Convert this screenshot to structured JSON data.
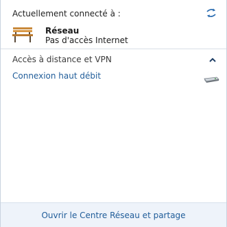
{
  "header": {
    "connected_label": "Actuellement connecté à :",
    "refresh_icon": "refresh-arrows-icon"
  },
  "network": {
    "name": "Réseau",
    "status": "Pas d'accès Internet",
    "icon": "park-bench-icon"
  },
  "group": {
    "title": "Accès à distance et VPN",
    "collapse_icon": "chevron-up-icon",
    "items": [
      {
        "label": "Connexion haut débit",
        "icon": "modem-icon"
      }
    ]
  },
  "footer": {
    "link_label": "Ouvrir le Centre Réseau et partage"
  },
  "colors": {
    "link": "#1f5c99",
    "footer_bg": "#eef3fa"
  }
}
